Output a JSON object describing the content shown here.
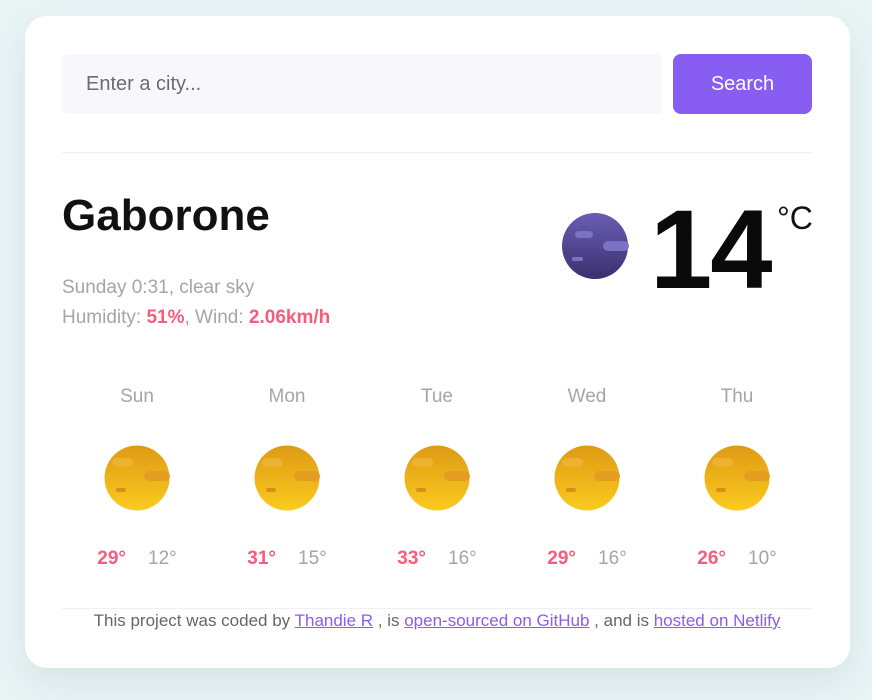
{
  "search": {
    "placeholder": "Enter a city...",
    "button_label": "Search"
  },
  "current": {
    "city": "Gaborone",
    "datetime_desc": "Sunday 0:31, clear sky",
    "humidity_label": "Humidity: ",
    "humidity_value": "51%",
    "wind_label": ", Wind: ",
    "wind_value": "2.06km/h",
    "temperature": "14",
    "unit": "°C",
    "icon": "moon-night-icon"
  },
  "forecast": [
    {
      "day": "Sun",
      "max": "29°",
      "min": "12°",
      "icon": "sun-icon"
    },
    {
      "day": "Mon",
      "max": "31°",
      "min": "15°",
      "icon": "sun-icon"
    },
    {
      "day": "Tue",
      "max": "33°",
      "min": "16°",
      "icon": "sun-icon"
    },
    {
      "day": "Wed",
      "max": "29°",
      "min": "16°",
      "icon": "sun-icon"
    },
    {
      "day": "Thu",
      "max": "26°",
      "min": "10°",
      "icon": "sun-icon"
    }
  ],
  "footer": {
    "text1": "This project was coded by ",
    "author_link": "Thandie R",
    "text2": " , is ",
    "github_link": "open-sourced on GitHub",
    "text3": " , and is ",
    "netlify_link": "hosted on Netlify"
  },
  "colors": {
    "accent": "#885df1",
    "highlight": "#f65c7c",
    "muted": "#a4a4ac",
    "background": "#e8f3f4"
  }
}
